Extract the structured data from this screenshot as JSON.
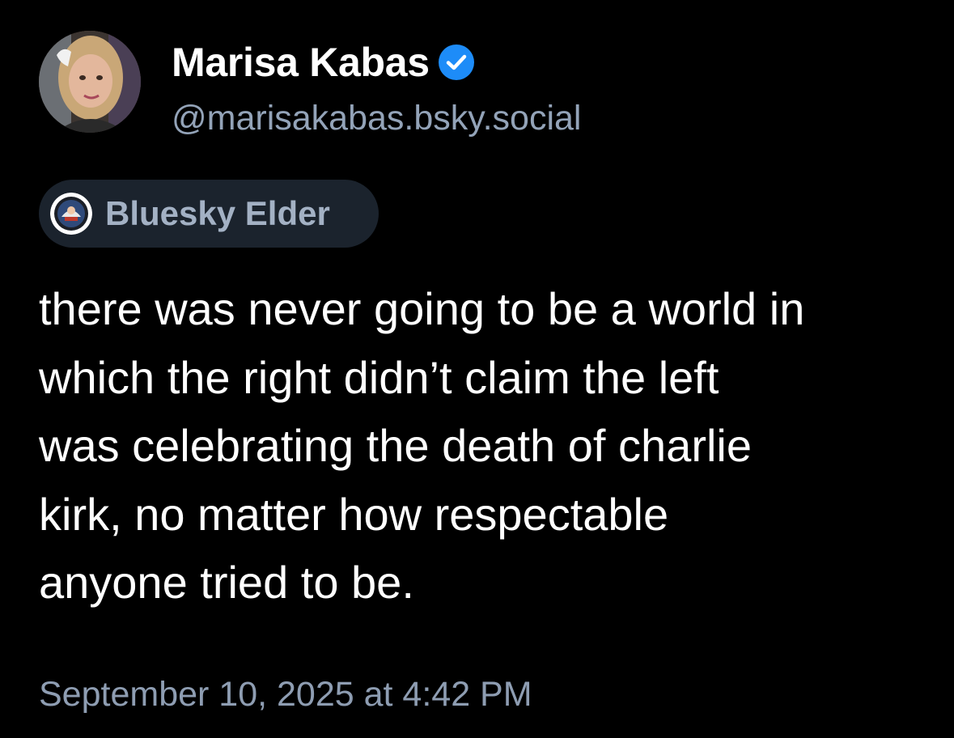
{
  "author": {
    "display_name": "Marisa Kabas",
    "handle": "@marisakabas.bsky.social",
    "verified": true
  },
  "label": {
    "text": "Bluesky Elder"
  },
  "post": {
    "text": "there was never going to be a world in\nwhich the right didn’t claim the left\nwas celebrating the death of charlie\nkirk, no matter how respectable\nanyone tried to be.",
    "timestamp": "September 10, 2025 at 4:42 PM"
  },
  "icons": {
    "avatar": "user-avatar-photo",
    "verified": "verified-check-icon",
    "label": "bluesky-elder-badge-icon"
  },
  "colors": {
    "background": "#000000",
    "text": "#ffffff",
    "secondary_text": "#93a3b8",
    "verified_blue": "#1d8cf8",
    "pill_background": "#1b232d"
  }
}
